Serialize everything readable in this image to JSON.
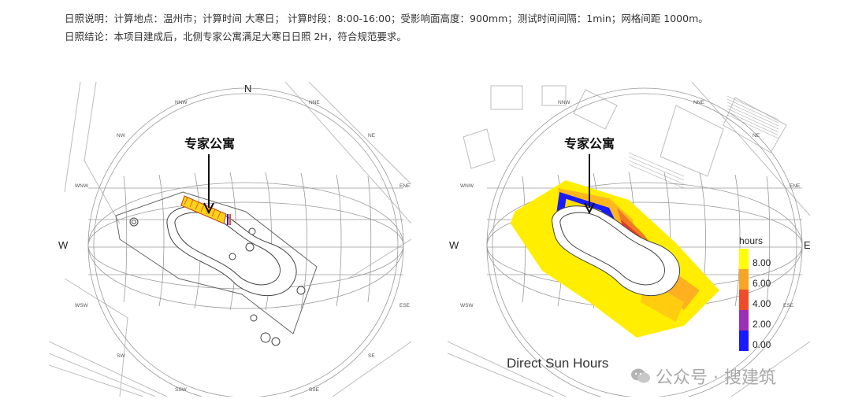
{
  "notes": {
    "line1": "日照说明：计算地点：温州市；计算时间 大寒日；  计算时段：8:00-16:00；受影响面高度：900mm；测试时间间隔：1min；网格间距 1000m。",
    "line2": "日照结论：本项目建成后，北侧专家公寓满足大寒日日照 2H，符合规范要求。"
  },
  "compass": {
    "N": "N",
    "NNE": "NNE",
    "NE": "NE",
    "ENE": "ENE",
    "E": "E",
    "ESE": "ESE",
    "SE": "SE",
    "SSE": "SSE",
    "SW": "SW",
    "SSW": "SSW",
    "WSW": "WSW",
    "W": "W",
    "WNW": "WNW",
    "NW": "NW",
    "NNW": "NNW"
  },
  "left_panel": {
    "building_label": "专家公寓"
  },
  "right_panel": {
    "building_label": "专家公寓",
    "caption": "Direct Sun Hours",
    "legend": {
      "title": "hours",
      "ticks": [
        "8.00",
        "6.00",
        "4.00",
        "2.00",
        "0.00"
      ],
      "colors": [
        "#ffff00",
        "#f6a623",
        "#ef4c2a",
        "#9b2fb5",
        "#1a1aff"
      ]
    }
  },
  "watermark": {
    "text": "公众号 · 搜建筑",
    "icon": "wechat-icon"
  }
}
